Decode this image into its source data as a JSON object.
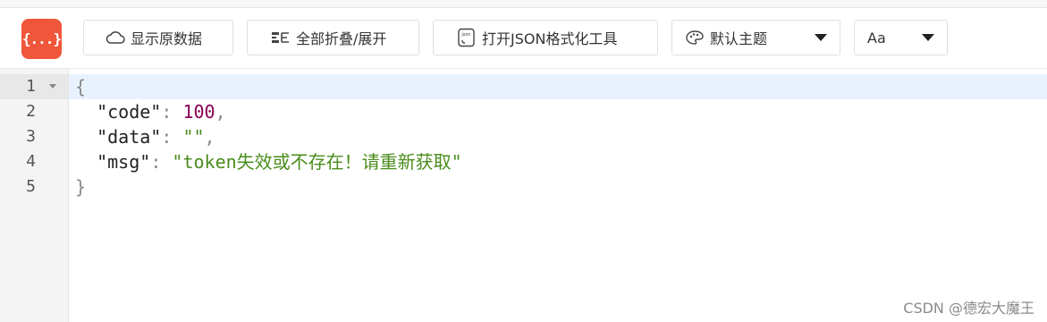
{
  "toolbar": {
    "logo_text": "{...}",
    "show_raw_label": "显示原数据",
    "fold_all_label": "全部折叠/展开",
    "open_json_tool_label": "打开JSON格式化工具",
    "theme_selected": "默认主题",
    "font_selected": "Aa"
  },
  "editor": {
    "line_numbers": [
      "1",
      "2",
      "3",
      "4",
      "5"
    ],
    "lines": {
      "l1": {
        "brace": "{"
      },
      "l2": {
        "indent": "  ",
        "key": "\"code\"",
        "colon": ": ",
        "value": "100",
        "comma": ","
      },
      "l3": {
        "indent": "  ",
        "key": "\"data\"",
        "colon": ": ",
        "value": "\"\"",
        "comma": ","
      },
      "l4": {
        "indent": "  ",
        "key": "\"msg\"",
        "colon": ": ",
        "value": "\"token失效或不存在！请重新获取\""
      },
      "l5": {
        "brace": "}"
      }
    }
  },
  "watermark": "CSDN @德宏大魔王",
  "colors": {
    "logo_bg": "#f0563a",
    "active_line": "#e8f2ff",
    "number": "#880055",
    "string": "#4a8c1c"
  },
  "icons": {
    "show_raw": "cloud-icon",
    "fold_all": "fold-icon",
    "open_json_tool": "json-file-icon",
    "theme": "palette-icon",
    "font": "font-size-icon"
  }
}
